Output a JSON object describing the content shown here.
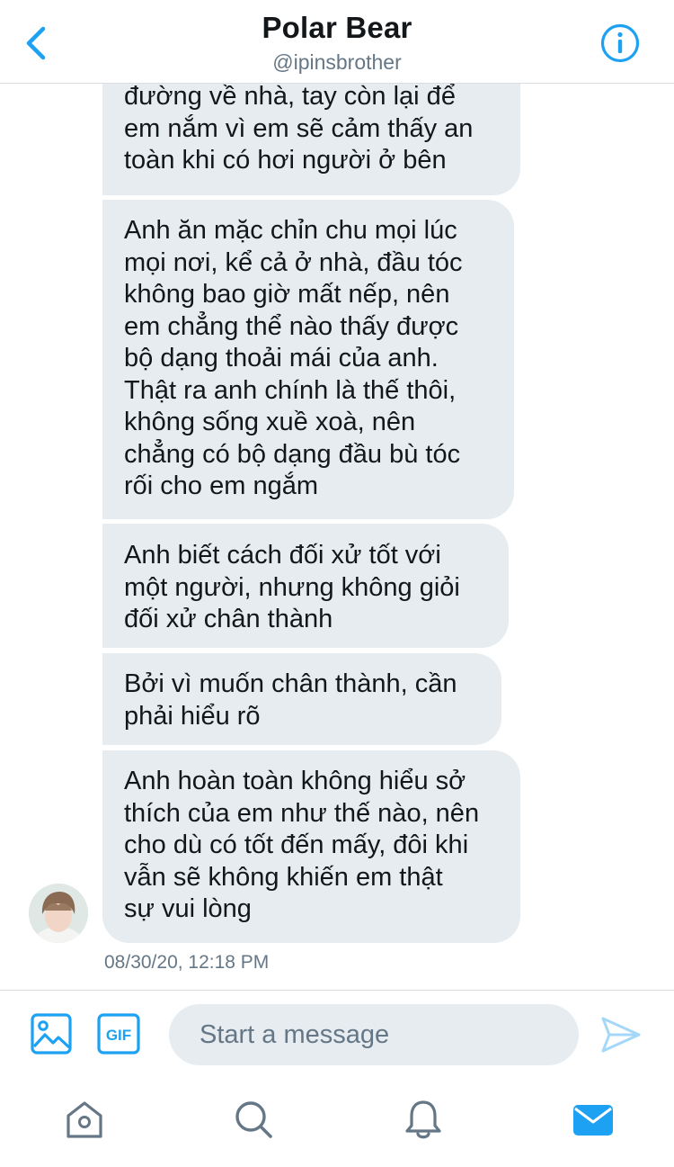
{
  "header": {
    "title": "Polar Bear",
    "handle": "@ipinsbrother"
  },
  "messages": [
    {
      "text": "đường về nhà, tay còn lại để\nem nắm vì em sẽ cảm thấy an\ntoàn khi có hơi người ở bên"
    },
    {
      "text": "Anh ăn mặc chỉn chu mọi lúc\nmọi nơi, kể cả ở nhà, đầu tóc\nkhông bao giờ mất nếp, nên\nem chẳng thể nào thấy được\nbộ dạng thoải mái của anh.\nThật ra anh chính là thế thôi,\nkhông sống xuề xoà, nên\nchẳng có bộ dạng đầu bù tóc\nrối cho em ngắm"
    },
    {
      "text": "Anh biết cách đối xử tốt với\nmột người, nhưng không giỏi\nđối xử chân thành"
    },
    {
      "text": "Bởi vì muốn chân thành, cần\nphải hiểu rõ"
    },
    {
      "text": "Anh hoàn toàn không hiểu sở\nthích của em như thế nào, nên\ncho dù có tốt đến mấy, đôi khi\nvẫn sẽ không khiến em thật\nsự vui lòng"
    }
  ],
  "timestamp": "08/30/20, 12:18 PM",
  "composer": {
    "placeholder": "Start a message",
    "gif_label": "GIF"
  },
  "tabs": [
    "home",
    "search",
    "notifications",
    "messages"
  ],
  "colors": {
    "accent": "#1da1f2",
    "bubble": "#e6ecf0",
    "secondary_text": "#657786",
    "send_disabled": "#a5d8f8"
  }
}
